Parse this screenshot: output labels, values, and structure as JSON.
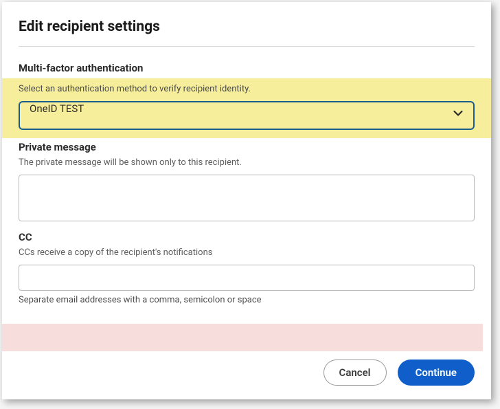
{
  "dialog": {
    "title": "Edit recipient settings"
  },
  "mfa": {
    "section_label": "Multi-factor authentication",
    "helper": "Select an authentication method to verify recipient identity.",
    "selected": "OneID TEST"
  },
  "private_message": {
    "section_label": "Private message",
    "description": "The private message will be shown only to this recipient.",
    "value": ""
  },
  "cc": {
    "section_label": "CC",
    "description": "CCs receive a copy of the recipient's notifications",
    "value": "",
    "hint": "Separate email addresses with a comma, semicolon or space"
  },
  "footer": {
    "cancel_label": "Cancel",
    "continue_label": "Continue"
  }
}
